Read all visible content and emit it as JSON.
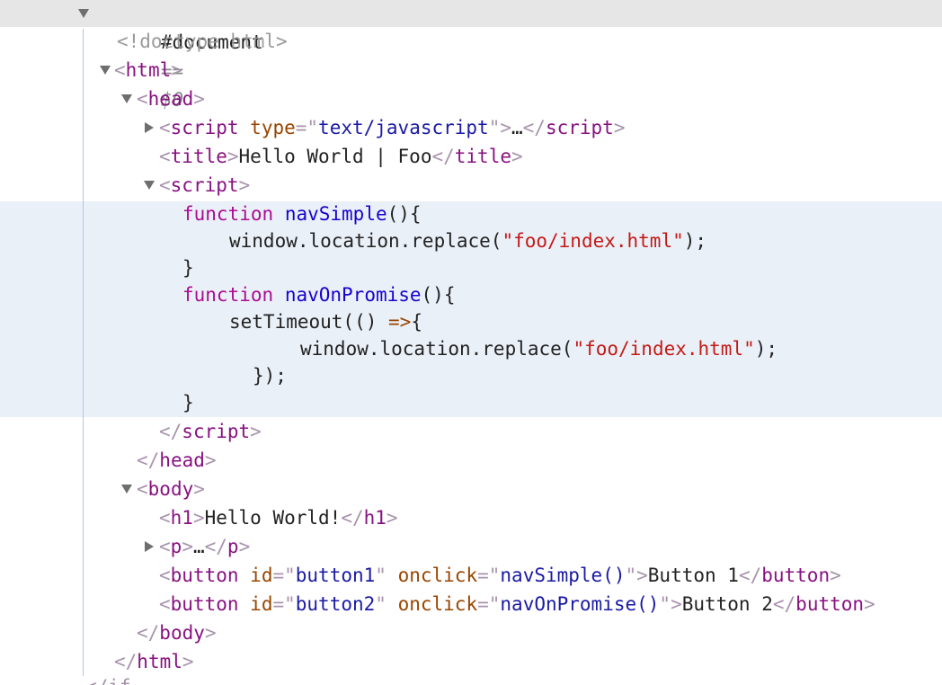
{
  "document_node": {
    "label": "#document",
    "eq": "==",
    "var": "$0"
  },
  "doctype": "<!doctype html>",
  "tags": {
    "html": "html",
    "head": "head",
    "script": "script",
    "title": "title",
    "body": "body",
    "h1": "h1",
    "p": "p",
    "button": "button"
  },
  "script1": {
    "attr_name": "type",
    "attr_value": "text/javascript",
    "ellipsis": "…"
  },
  "title_text": "Hello World | Foo",
  "script_body": {
    "line1_kw": "function",
    "line1_fn": "navSimple",
    "line1_rest": "(){",
    "line2_pre": "window.location.replace(",
    "line2_str": "\"foo/index.html\"",
    "line2_post": ");",
    "line3": "}",
    "line4_kw": "function",
    "line4_fn": "navOnPromise",
    "line4_rest": "(){",
    "line5_pre": "setTimeout(() ",
    "line5_arrow": "=>",
    "line5_post": "{",
    "line6_pre": "window.location.replace(",
    "line6_str": "\"foo/index.html\"",
    "line6_post": ");",
    "line7": "});",
    "line8": "}"
  },
  "h1_text": "Hello World!",
  "p_ellipsis": "…",
  "buttons": [
    {
      "id_attr": "id",
      "id_value": "button1",
      "onclick_attr": "onclick",
      "onclick_value": "navSimple()",
      "text": "Button 1"
    },
    {
      "id_attr": "id",
      "id_value": "button2",
      "onclick_attr": "onclick",
      "onclick_value": "navOnPromise()",
      "text": "Button 2"
    }
  ],
  "cut_off_text": "</if"
}
